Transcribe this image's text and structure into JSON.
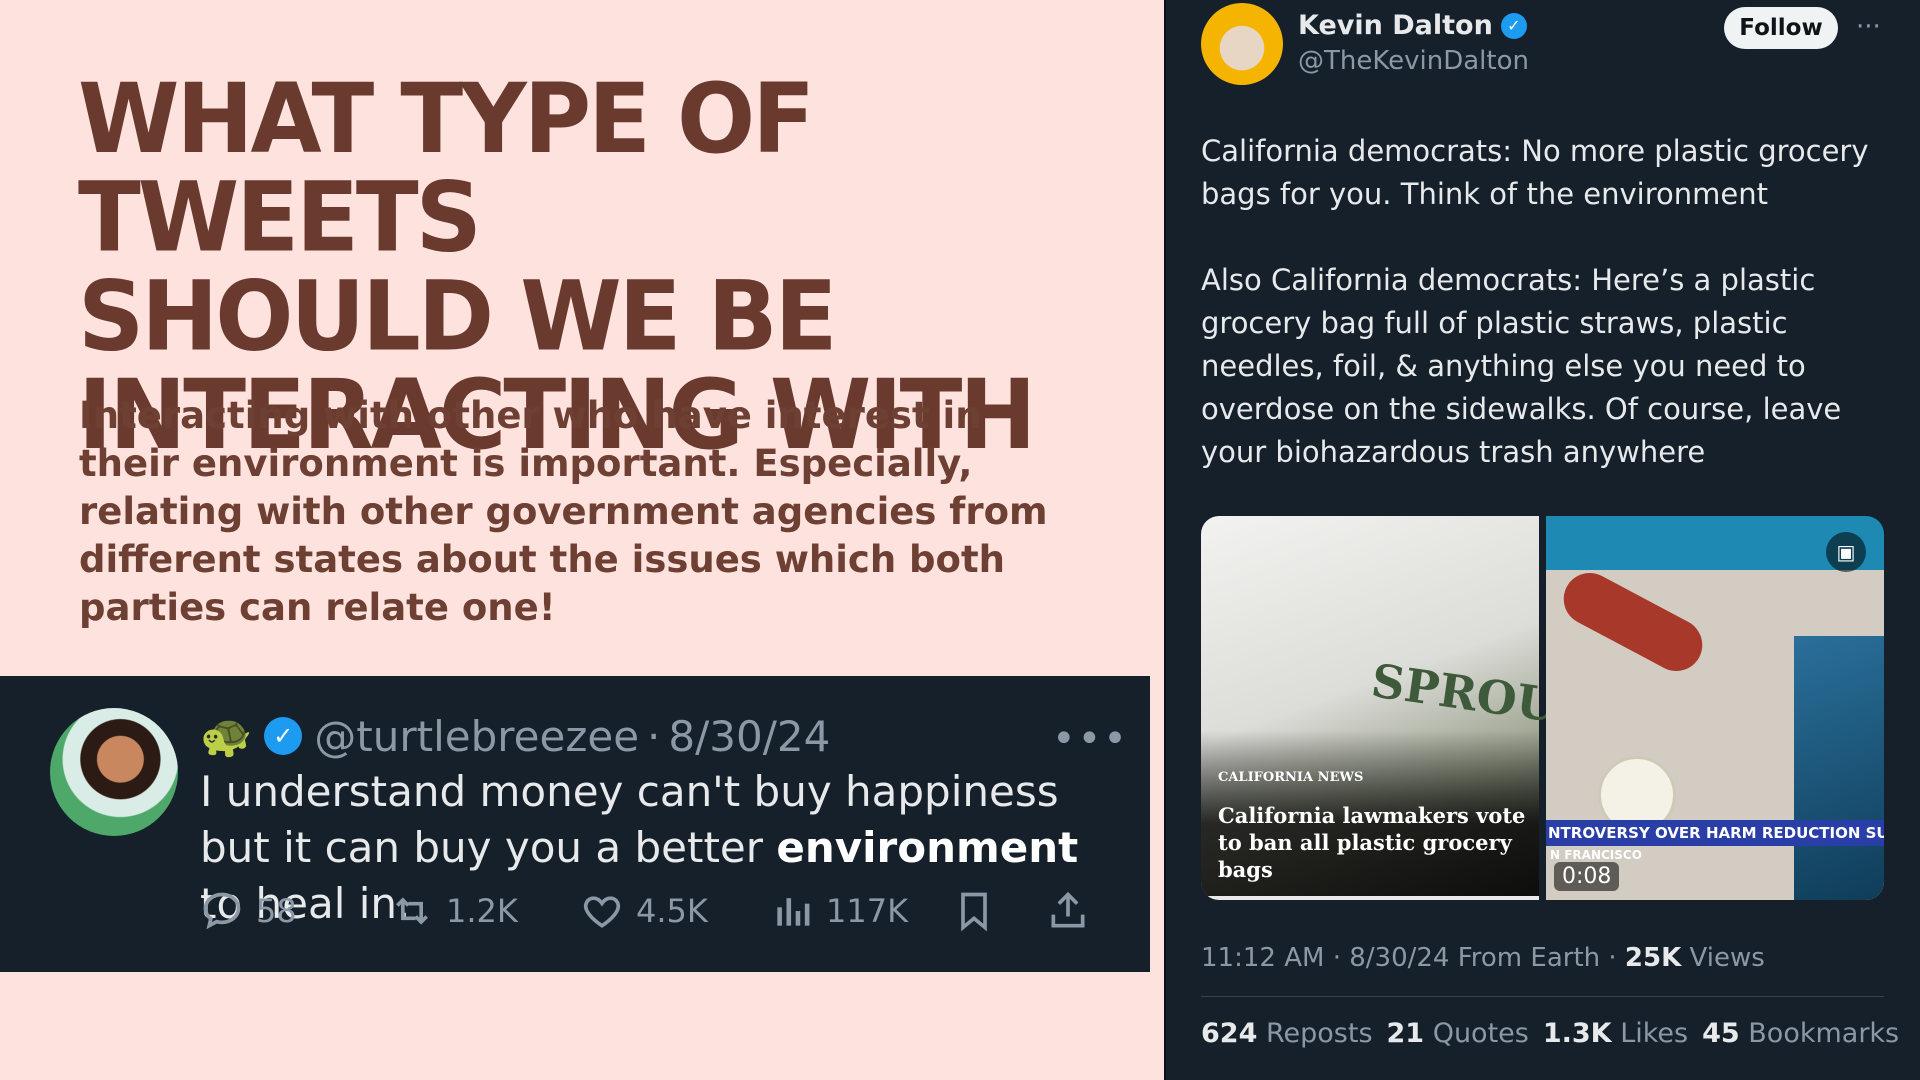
{
  "slide": {
    "headline_lines": [
      "WHAT TYPE OF TWEETS",
      "SHOULD WE BE",
      "INTERACTING WITH"
    ],
    "subtext": "Interacting with other who have interest in their environment is important. Especially, relating with other government agencies from different states about the issues which both parties can relate one!"
  },
  "embedded_tweet": {
    "emoji": "🐢",
    "handle": "@turtlebreezee",
    "separator": "·",
    "date": "8/30/24",
    "more": "•••",
    "body_before": "I understand money can't buy happiness but it can buy you a better ",
    "body_bold": "environment",
    "body_after": " to heal in.",
    "actions": {
      "replies": "58",
      "reposts": "1.2K",
      "likes": "4.5K",
      "views": "117K"
    }
  },
  "main_tweet": {
    "name": "Kevin Dalton",
    "handle": "@TheKevinDalton",
    "follow_label": "Follow",
    "more": "···",
    "paragraph1": "California democrats: No more plastic grocery bags for you. Think of the environment",
    "paragraph2": "Also California democrats: Here’s a plastic grocery bag full of plastic straws, plastic needles, foil, & anything else you need to overdose on the sidewalks. Of course, leave your biohazardous trash anywhere",
    "media": {
      "left_logo_text": "SPROU",
      "left_kicker": "CALIFORNIA NEWS",
      "left_title": "California lawmakers vote to ban all plastic grocery bags",
      "right_ticker": "NTROVERSY OVER HARM REDUCTION SUPPL",
      "right_ticker_sub": "N FRANCISCO",
      "right_duration": "0:08"
    },
    "meta": {
      "time": "11:12 AM",
      "date": "8/30/24",
      "source": "From Earth",
      "views_value": "25K",
      "views_label": "Views"
    },
    "stats": [
      {
        "value": "624",
        "label": "Reposts"
      },
      {
        "value": "21",
        "label": "Quotes"
      },
      {
        "value": "1.3K",
        "label": "Likes"
      },
      {
        "value": "45",
        "label": "Bookmarks"
      }
    ]
  },
  "colors": {
    "slide_background": "#fde2de",
    "headline": "#6b3a2e",
    "tweet_background": "#15202b",
    "verified_blue": "#1d9bf0"
  },
  "icons": [
    "turtle-emoji",
    "verified-badge-icon",
    "more-icon",
    "reply-icon",
    "repost-icon",
    "like-icon",
    "views-icon",
    "bookmark-icon",
    "share-icon",
    "media-alt-icon"
  ]
}
